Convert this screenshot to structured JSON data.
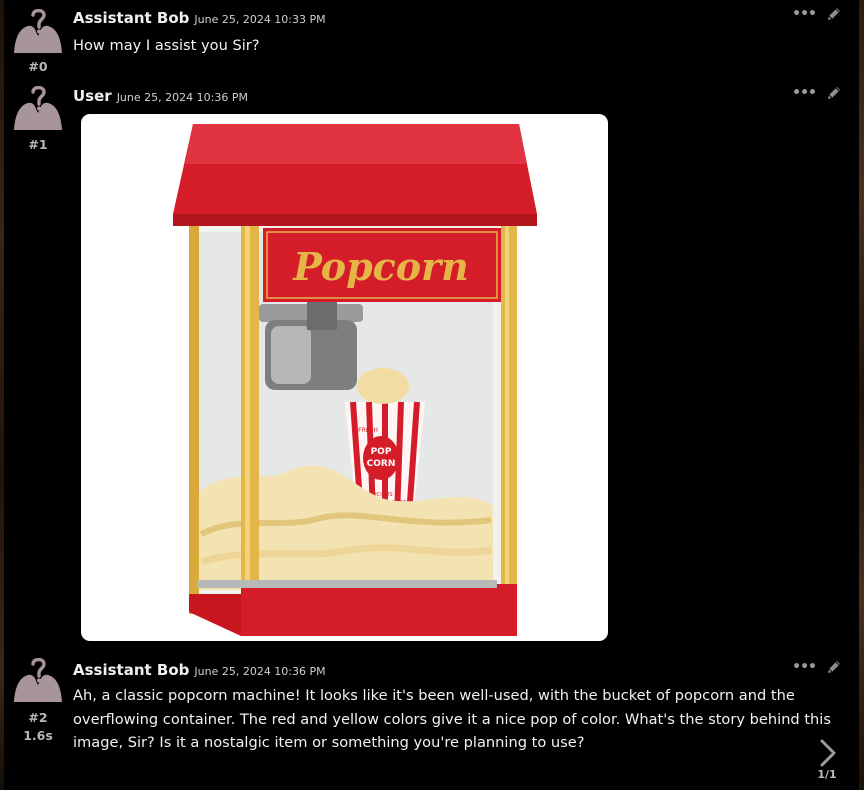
{
  "messages": [
    {
      "name": "Assistant Bob",
      "date": "June 25, 2024 10:33 PM",
      "id": "#0",
      "text": "How may I assist you Sir?"
    },
    {
      "name": "User",
      "date": "June 25, 2024 10:36 PM",
      "id": "#1",
      "attachment": {
        "sign_text": "Popcorn",
        "box_text_top": "FRESH",
        "box_text_mid_1": "POP",
        "box_text_mid_2": "CORN",
        "box_text_bottom_1": "DELICIOUS",
        "box_text_bottom_2": "CRISP"
      }
    },
    {
      "name": "Assistant Bob",
      "date": "June 25, 2024 10:36 PM",
      "id": "#2",
      "time_taken": "1.6s",
      "lines": [
        "Ah, a classic popcorn machine! It looks like it's been well-used, with the bucket of popcorn and the",
        "overflowing container. The red and yellow colors give it a nice pop of color. What's the story behind this",
        "image, Sir? Is it a nostalgic item or something you're planning to use?"
      ]
    }
  ],
  "actions": {
    "more_label": "•••"
  },
  "swipe": {
    "counter": "1/1"
  },
  "colors": {
    "background": "#000000",
    "machine_red": "#d51d2a",
    "frame_gold": "#d9a93a"
  },
  "icons": [
    "avatar-icon",
    "more-icon",
    "edit-icon",
    "chevron-right-icon"
  ]
}
